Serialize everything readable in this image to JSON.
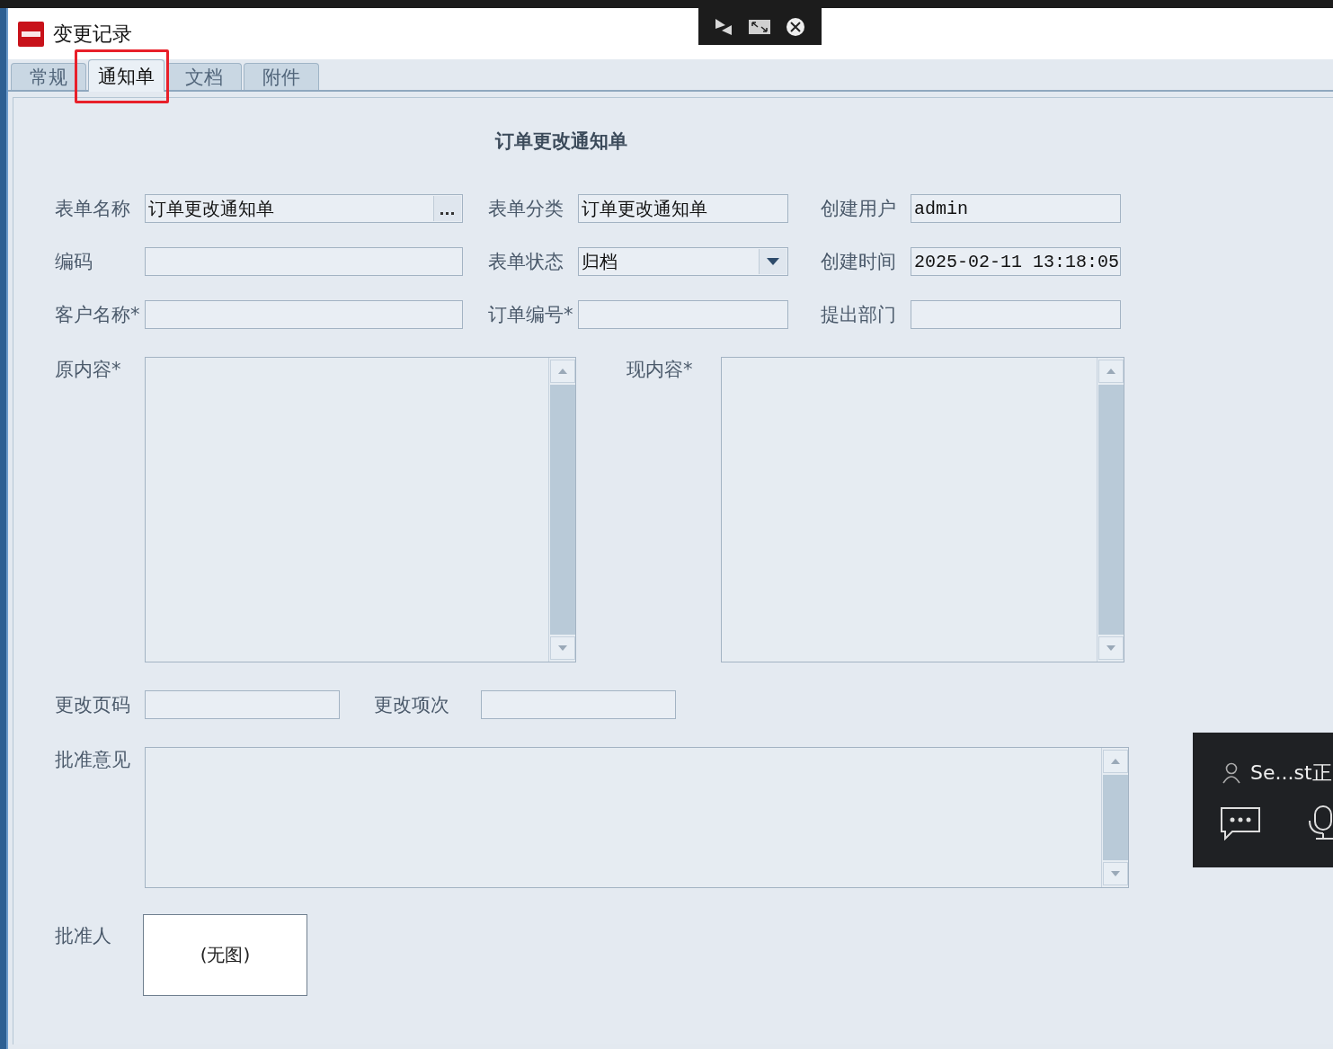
{
  "window": {
    "title": "变更记录"
  },
  "tabs": [
    {
      "label": "常规",
      "selected": false
    },
    {
      "label": "通知单",
      "selected": true
    },
    {
      "label": "文档",
      "selected": false
    },
    {
      "label": "附件",
      "selected": false
    }
  ],
  "form": {
    "title": "订单更改通知单",
    "fields": [
      {
        "label": "表单名称",
        "value": "订单更改通知单",
        "kind": "picker"
      },
      {
        "label": "表单分类",
        "value": "订单更改通知单",
        "kind": "text"
      },
      {
        "label": "创建用户",
        "value": "admin",
        "kind": "text"
      },
      {
        "label": "编码",
        "kind": "text"
      },
      {
        "label": "表单状态",
        "value": "归档",
        "kind": "dropdown"
      },
      {
        "label": "创建时间",
        "value": "2025-02-11 13:18:05",
        "kind": "text"
      },
      {
        "label": "客户名称*",
        "kind": "text"
      },
      {
        "label": "订单编号*",
        "kind": "text"
      },
      {
        "label": "提出部门",
        "kind": "text"
      }
    ],
    "original_content": {
      "label": "原内容*"
    },
    "new_content": {
      "label": "现内容*"
    },
    "change_page": {
      "label": "更改页码"
    },
    "change_item": {
      "label": "更改项次"
    },
    "approval_opinion": {
      "label": "批准意见"
    },
    "approver": {
      "label": "批准人",
      "image_text": "(无图)"
    }
  },
  "call_panel": {
    "caller": "Se...st正"
  }
}
